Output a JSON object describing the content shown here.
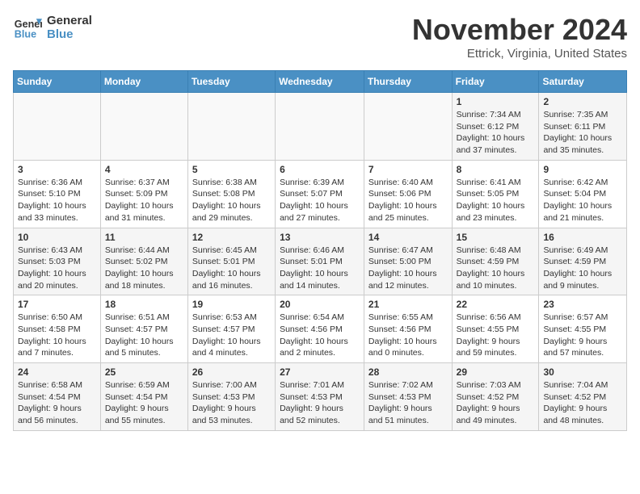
{
  "header": {
    "logo_line1": "General",
    "logo_line2": "Blue",
    "month_title": "November 2024",
    "location": "Ettrick, Virginia, United States"
  },
  "weekdays": [
    "Sunday",
    "Monday",
    "Tuesday",
    "Wednesday",
    "Thursday",
    "Friday",
    "Saturday"
  ],
  "weeks": [
    [
      {
        "day": "",
        "info": ""
      },
      {
        "day": "",
        "info": ""
      },
      {
        "day": "",
        "info": ""
      },
      {
        "day": "",
        "info": ""
      },
      {
        "day": "",
        "info": ""
      },
      {
        "day": "1",
        "info": "Sunrise: 7:34 AM\nSunset: 6:12 PM\nDaylight: 10 hours and 37 minutes."
      },
      {
        "day": "2",
        "info": "Sunrise: 7:35 AM\nSunset: 6:11 PM\nDaylight: 10 hours and 35 minutes."
      }
    ],
    [
      {
        "day": "3",
        "info": "Sunrise: 6:36 AM\nSunset: 5:10 PM\nDaylight: 10 hours and 33 minutes."
      },
      {
        "day": "4",
        "info": "Sunrise: 6:37 AM\nSunset: 5:09 PM\nDaylight: 10 hours and 31 minutes."
      },
      {
        "day": "5",
        "info": "Sunrise: 6:38 AM\nSunset: 5:08 PM\nDaylight: 10 hours and 29 minutes."
      },
      {
        "day": "6",
        "info": "Sunrise: 6:39 AM\nSunset: 5:07 PM\nDaylight: 10 hours and 27 minutes."
      },
      {
        "day": "7",
        "info": "Sunrise: 6:40 AM\nSunset: 5:06 PM\nDaylight: 10 hours and 25 minutes."
      },
      {
        "day": "8",
        "info": "Sunrise: 6:41 AM\nSunset: 5:05 PM\nDaylight: 10 hours and 23 minutes."
      },
      {
        "day": "9",
        "info": "Sunrise: 6:42 AM\nSunset: 5:04 PM\nDaylight: 10 hours and 21 minutes."
      }
    ],
    [
      {
        "day": "10",
        "info": "Sunrise: 6:43 AM\nSunset: 5:03 PM\nDaylight: 10 hours and 20 minutes."
      },
      {
        "day": "11",
        "info": "Sunrise: 6:44 AM\nSunset: 5:02 PM\nDaylight: 10 hours and 18 minutes."
      },
      {
        "day": "12",
        "info": "Sunrise: 6:45 AM\nSunset: 5:01 PM\nDaylight: 10 hours and 16 minutes."
      },
      {
        "day": "13",
        "info": "Sunrise: 6:46 AM\nSunset: 5:01 PM\nDaylight: 10 hours and 14 minutes."
      },
      {
        "day": "14",
        "info": "Sunrise: 6:47 AM\nSunset: 5:00 PM\nDaylight: 10 hours and 12 minutes."
      },
      {
        "day": "15",
        "info": "Sunrise: 6:48 AM\nSunset: 4:59 PM\nDaylight: 10 hours and 10 minutes."
      },
      {
        "day": "16",
        "info": "Sunrise: 6:49 AM\nSunset: 4:59 PM\nDaylight: 10 hours and 9 minutes."
      }
    ],
    [
      {
        "day": "17",
        "info": "Sunrise: 6:50 AM\nSunset: 4:58 PM\nDaylight: 10 hours and 7 minutes."
      },
      {
        "day": "18",
        "info": "Sunrise: 6:51 AM\nSunset: 4:57 PM\nDaylight: 10 hours and 5 minutes."
      },
      {
        "day": "19",
        "info": "Sunrise: 6:53 AM\nSunset: 4:57 PM\nDaylight: 10 hours and 4 minutes."
      },
      {
        "day": "20",
        "info": "Sunrise: 6:54 AM\nSunset: 4:56 PM\nDaylight: 10 hours and 2 minutes."
      },
      {
        "day": "21",
        "info": "Sunrise: 6:55 AM\nSunset: 4:56 PM\nDaylight: 10 hours and 0 minutes."
      },
      {
        "day": "22",
        "info": "Sunrise: 6:56 AM\nSunset: 4:55 PM\nDaylight: 9 hours and 59 minutes."
      },
      {
        "day": "23",
        "info": "Sunrise: 6:57 AM\nSunset: 4:55 PM\nDaylight: 9 hours and 57 minutes."
      }
    ],
    [
      {
        "day": "24",
        "info": "Sunrise: 6:58 AM\nSunset: 4:54 PM\nDaylight: 9 hours and 56 minutes."
      },
      {
        "day": "25",
        "info": "Sunrise: 6:59 AM\nSunset: 4:54 PM\nDaylight: 9 hours and 55 minutes."
      },
      {
        "day": "26",
        "info": "Sunrise: 7:00 AM\nSunset: 4:53 PM\nDaylight: 9 hours and 53 minutes."
      },
      {
        "day": "27",
        "info": "Sunrise: 7:01 AM\nSunset: 4:53 PM\nDaylight: 9 hours and 52 minutes."
      },
      {
        "day": "28",
        "info": "Sunrise: 7:02 AM\nSunset: 4:53 PM\nDaylight: 9 hours and 51 minutes."
      },
      {
        "day": "29",
        "info": "Sunrise: 7:03 AM\nSunset: 4:52 PM\nDaylight: 9 hours and 49 minutes."
      },
      {
        "day": "30",
        "info": "Sunrise: 7:04 AM\nSunset: 4:52 PM\nDaylight: 9 hours and 48 minutes."
      }
    ]
  ]
}
